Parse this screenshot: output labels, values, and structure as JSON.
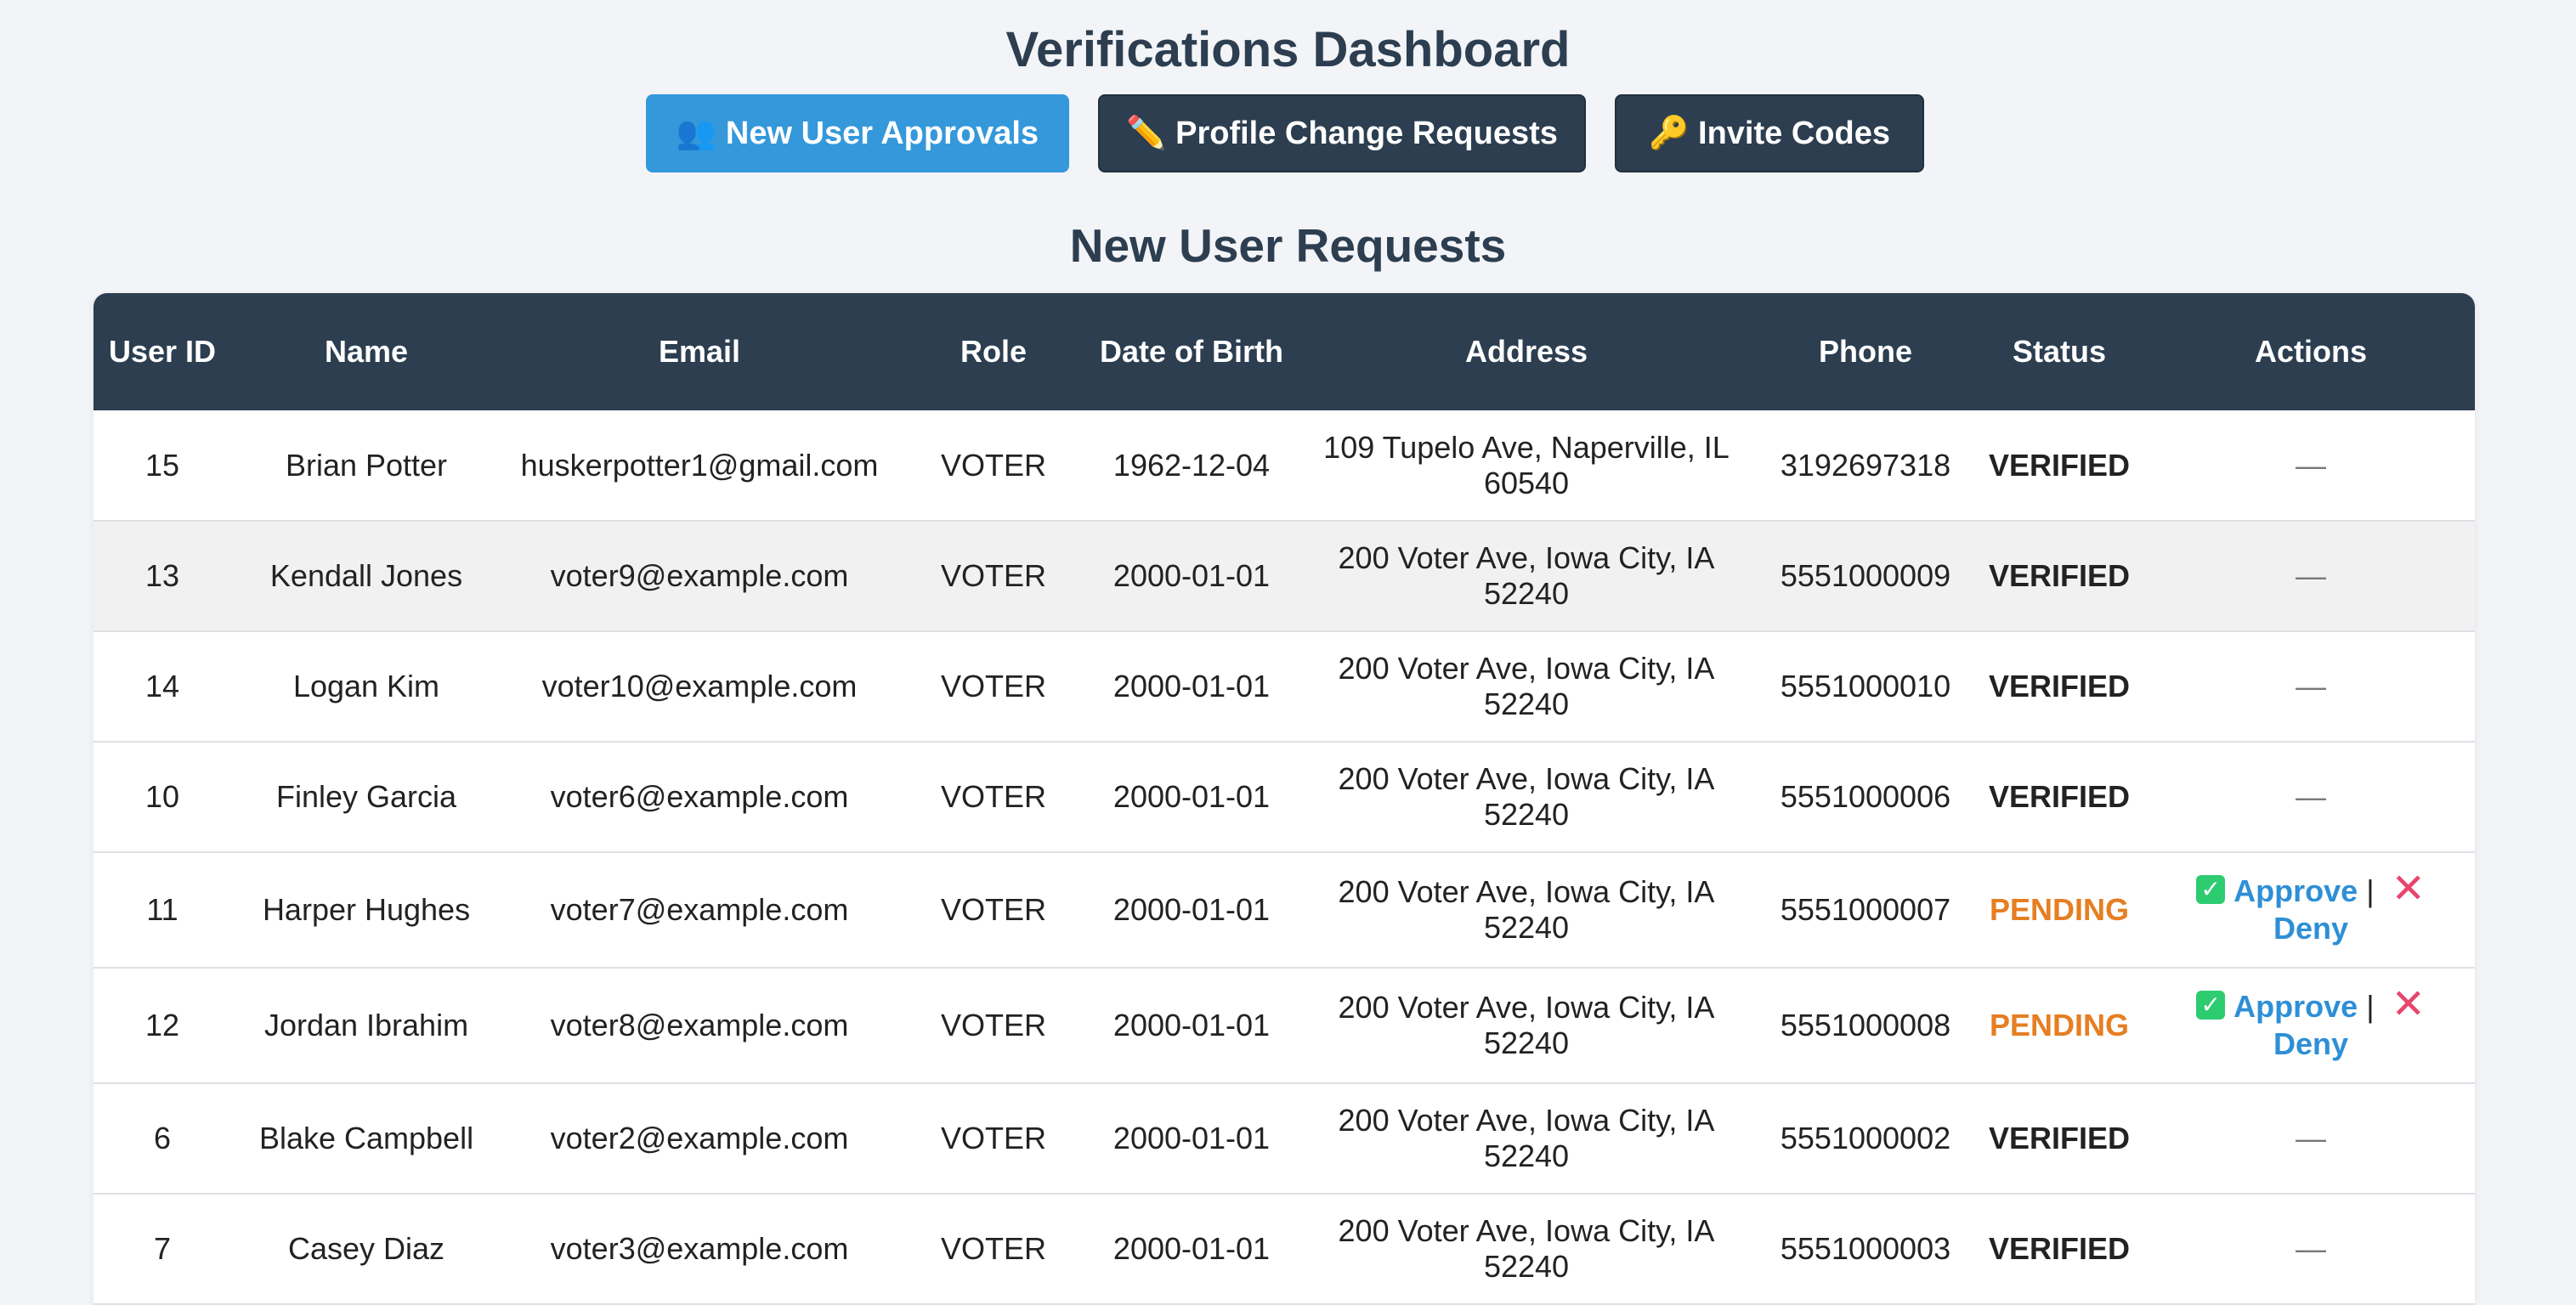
{
  "page": {
    "title": "Verifications Dashboard"
  },
  "tabs": [
    {
      "label": "New User Approvals",
      "icon": "users-icon",
      "glyph": "👥",
      "active": true
    },
    {
      "label": "Profile Change Requests",
      "icon": "pencil-icon",
      "glyph": "✏️",
      "active": false
    },
    {
      "label": "Invite Codes",
      "icon": "key-icon",
      "glyph": "🔑",
      "active": false
    }
  ],
  "section": {
    "title": "New User Requests"
  },
  "table": {
    "headers": {
      "user_id": "User ID",
      "name": "Name",
      "email": "Email",
      "role": "Role",
      "dob": "Date of Birth",
      "address": "Address",
      "phone": "Phone",
      "status": "Status",
      "actions": "Actions"
    },
    "rows": [
      {
        "user_id": "15",
        "name": "Brian Potter",
        "email": "huskerpotter1@gmail.com",
        "role": "VOTER",
        "dob": "1962-12-04",
        "address": "109 Tupelo Ave, Naperville, IL 60540",
        "phone": "3192697318",
        "status": "VERIFIED",
        "actions": "—"
      },
      {
        "user_id": "13",
        "name": "Kendall Jones",
        "email": "voter9@example.com",
        "role": "VOTER",
        "dob": "2000-01-01",
        "address": "200 Voter Ave, Iowa City, IA 52240",
        "phone": "5551000009",
        "status": "VERIFIED",
        "actions": "—"
      },
      {
        "user_id": "14",
        "name": "Logan Kim",
        "email": "voter10@example.com",
        "role": "VOTER",
        "dob": "2000-01-01",
        "address": "200 Voter Ave, Iowa City, IA 52240",
        "phone": "5551000010",
        "status": "VERIFIED",
        "actions": "—"
      },
      {
        "user_id": "10",
        "name": "Finley Garcia",
        "email": "voter6@example.com",
        "role": "VOTER",
        "dob": "2000-01-01",
        "address": "200 Voter Ave, Iowa City, IA 52240",
        "phone": "5551000006",
        "status": "VERIFIED",
        "actions": "—"
      },
      {
        "user_id": "11",
        "name": "Harper Hughes",
        "email": "voter7@example.com",
        "role": "VOTER",
        "dob": "2000-01-01",
        "address": "200 Voter Ave, Iowa City, IA 52240",
        "phone": "5551000007",
        "status": "PENDING",
        "approve": "Approve",
        "separator": "|",
        "deny": "Deny"
      },
      {
        "user_id": "12",
        "name": "Jordan Ibrahim",
        "email": "voter8@example.com",
        "role": "VOTER",
        "dob": "2000-01-01",
        "address": "200 Voter Ave, Iowa City, IA 52240",
        "phone": "5551000008",
        "status": "PENDING",
        "approve": "Approve",
        "separator": "|",
        "deny": "Deny"
      },
      {
        "user_id": "6",
        "name": "Blake Campbell",
        "email": "voter2@example.com",
        "role": "VOTER",
        "dob": "2000-01-01",
        "address": "200 Voter Ave, Iowa City, IA 52240",
        "phone": "5551000002",
        "status": "VERIFIED",
        "actions": "—"
      },
      {
        "user_id": "7",
        "name": "Casey Diaz",
        "email": "voter3@example.com",
        "role": "VOTER",
        "dob": "2000-01-01",
        "address": "200 Voter Ave, Iowa City, IA 52240",
        "phone": "5551000003",
        "status": "VERIFIED",
        "actions": "—"
      }
    ]
  },
  "colors": {
    "header_bg": "#2c3e50",
    "active_tab": "#3498db",
    "pending": "#e67e22",
    "link": "#2e8fd6",
    "approve_icon": "#2ecc71",
    "deny_icon": "#e8456b"
  }
}
